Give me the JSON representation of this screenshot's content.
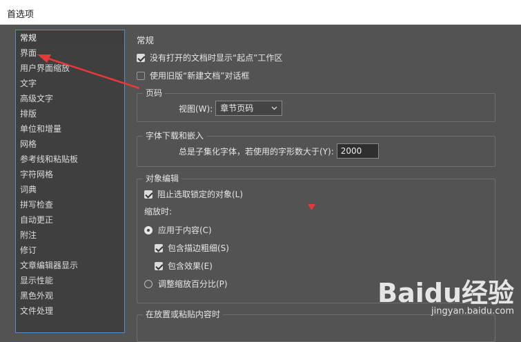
{
  "window": {
    "title": "首选项"
  },
  "sidebar": {
    "items": [
      {
        "label": "常规"
      },
      {
        "label": "界面"
      },
      {
        "label": "用户界面缩放"
      },
      {
        "label": "文字"
      },
      {
        "label": "高级文字"
      },
      {
        "label": "排版"
      },
      {
        "label": "单位和增量"
      },
      {
        "label": "网格"
      },
      {
        "label": "参考线和粘贴板"
      },
      {
        "label": "字符网格"
      },
      {
        "label": "词典"
      },
      {
        "label": "拼写检查"
      },
      {
        "label": "自动更正"
      },
      {
        "label": "附注"
      },
      {
        "label": "修订"
      },
      {
        "label": "文章编辑器显示"
      },
      {
        "label": "显示性能"
      },
      {
        "label": "黑色外观"
      },
      {
        "label": "文件处理"
      }
    ]
  },
  "main": {
    "heading": "常规",
    "show_start_workspace": {
      "label": "没有打开的文档时显示“起点”工作区",
      "checked": true
    },
    "legacy_new_doc": {
      "label": "使用旧版“新建文档”对话框",
      "checked": false
    },
    "page_numbers": {
      "title": "页码",
      "view_label": "视图(W):",
      "view_value": "章节页码"
    },
    "font_embed": {
      "title": "字体下载和嵌入",
      "subset_label": "总是子集化字体，若使用的字形数大于(Y):",
      "subset_value": "2000"
    },
    "object_edit": {
      "title": "对象编辑",
      "prevent_locked": {
        "label": "阻止选取锁定的对象(L)",
        "checked": true
      },
      "scale_label": "缩放时:",
      "apply_content": {
        "label": "应用于内容(C)",
        "selected": true
      },
      "include_stroke": {
        "label": "包含描边粗细(S)",
        "checked": true
      },
      "include_effects": {
        "label": "包含效果(E)",
        "checked": true
      },
      "adjust_percent": {
        "label": "调整缩放百分比(P)",
        "selected": false
      }
    },
    "paste_section": {
      "title": "在放置或粘贴内容时"
    }
  },
  "watermark": {
    "logo": "Baidu经验",
    "url": "jingyan.baidu.com"
  },
  "colors": {
    "annotation": "#e8393a",
    "panel": "#535353",
    "sidebar_border": "#5a8ec8"
  }
}
